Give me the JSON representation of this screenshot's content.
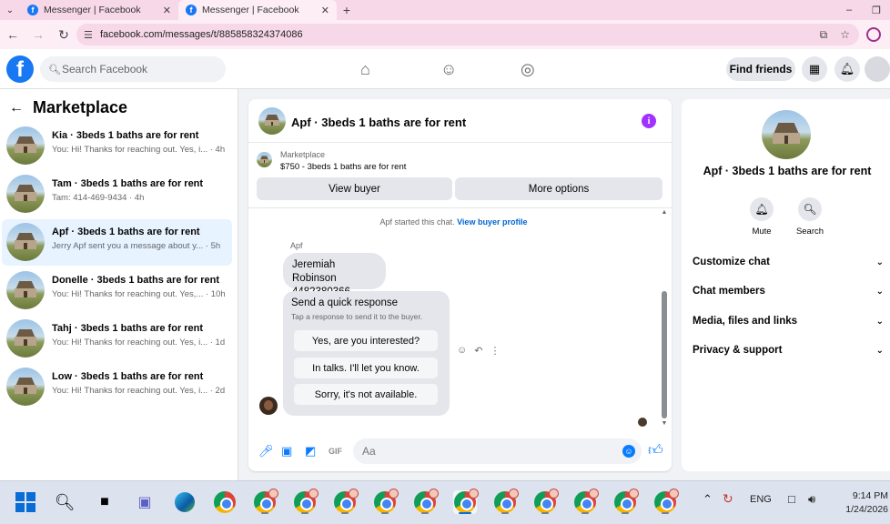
{
  "browser": {
    "tabs": [
      {
        "title": "Messenger | Facebook"
      },
      {
        "title": "Messenger | Facebook"
      }
    ],
    "url": "facebook.com/messages/t/885858324374086"
  },
  "header": {
    "search_placeholder": "Search Facebook",
    "find_friends": "Find friends"
  },
  "sidebar": {
    "title": "Marketplace",
    "conversations": [
      {
        "title": "Kia · 3beds 1 baths are for rent",
        "snippet": "You: Hi! Thanks for reaching out. Yes, i... · 4h"
      },
      {
        "title": "Tam · 3beds 1 baths are for rent",
        "snippet": "Tam: 414-469-9434 · 4h"
      },
      {
        "title": "Apf · 3beds 1 baths are for rent",
        "snippet": "Jerry Apf sent you a message about y... · 5h"
      },
      {
        "title": "Donelle · 3beds 1 baths are for rent",
        "snippet": "You: Hi! Thanks for reaching out. Yes,... · 10h"
      },
      {
        "title": "Tahj · 3beds 1 baths are for rent",
        "snippet": "You: Hi! Thanks for reaching out. Yes, i... · 1d"
      },
      {
        "title": "Low · 3beds 1 baths are for rent",
        "snippet": "You: Hi! Thanks for reaching out. Yes, i... · 2d"
      }
    ]
  },
  "chat": {
    "title": "Apf · 3beds 1 baths are for rent",
    "marketplace_label": "Marketplace",
    "listing": "$750 - 3beds 1 baths are for rent",
    "view_buyer": "View buyer",
    "more_options": "More options",
    "system_message": "Apf started this chat.",
    "view_buyer_profile": "View buyer profile",
    "sender": "Apf",
    "message_line1": "Jeremiah Robinson",
    "message_line2": "4482380366",
    "quick_title": "Send a quick response",
    "quick_subtitle": "Tap a response to send it to the buyer.",
    "quick_options": [
      "Yes, are you interested?",
      "In talks. I'll let you know.",
      "Sorry, it's not available."
    ],
    "input_placeholder": "Aa"
  },
  "details": {
    "title": "Apf · 3beds 1 baths are for rent",
    "mute": "Mute",
    "search": "Search",
    "sections": [
      "Customize chat",
      "Chat members",
      "Media, files and links",
      "Privacy & support"
    ]
  },
  "taskbar": {
    "language": "ENG",
    "time": "9:14 PM",
    "date": "1/24/2026"
  },
  "colors": {
    "brand": "#1877f2",
    "accent": "#0a7cff",
    "active_row": "#e7f3ff",
    "info_button": "#a033ff"
  }
}
